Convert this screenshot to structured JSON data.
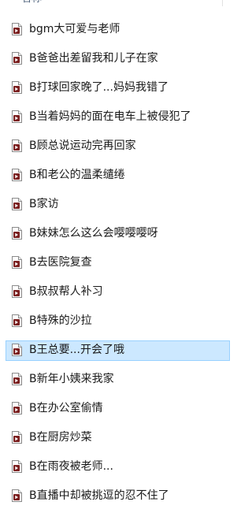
{
  "header": {
    "name_column": "名称"
  },
  "files": [
    {
      "name": "bgm大可爱与老师",
      "selected": false
    },
    {
      "name": "B爸爸出差留我和儿子在家",
      "selected": false
    },
    {
      "name": "B打球回家晚了...妈妈我错了",
      "selected": false
    },
    {
      "name": "B当着妈妈的面在电车上被侵犯了",
      "selected": false
    },
    {
      "name": "B顾总说运动完再回家",
      "selected": false
    },
    {
      "name": "B和老公的温柔缱绻",
      "selected": false
    },
    {
      "name": "B家访",
      "selected": false
    },
    {
      "name": "B妹妹怎么这么会嘤嘤嘤呀",
      "selected": false
    },
    {
      "name": "B去医院复查",
      "selected": false
    },
    {
      "name": "B叔叔帮人补习",
      "selected": false
    },
    {
      "name": "B特殊的沙拉",
      "selected": false
    },
    {
      "name": "B王总要...开会了哦",
      "selected": true
    },
    {
      "name": "B新年小姨来我家",
      "selected": false
    },
    {
      "name": "B在办公室偷情",
      "selected": false
    },
    {
      "name": "B在厨房炒菜",
      "selected": false
    },
    {
      "name": "B在雨夜被老师...",
      "selected": false
    },
    {
      "name": "B直播中却被挑逗的忍不住了",
      "selected": false
    }
  ],
  "icon": "audio-file-icon",
  "colors": {
    "selection_fill": "#cce8ff",
    "selection_border": "#99d1ff",
    "header_text": "#4c607a",
    "icon_badge": "#7a1f1f"
  }
}
